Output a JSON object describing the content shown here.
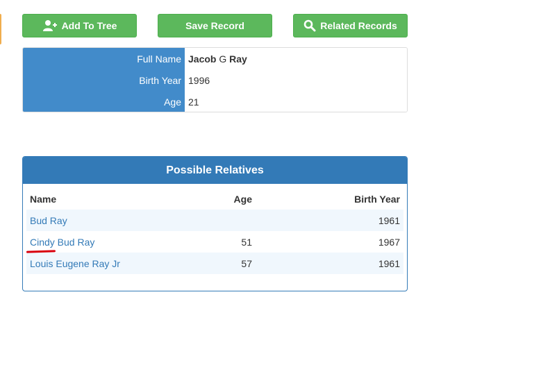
{
  "toolbar": {
    "add_to_tree": "Add To Tree",
    "save_record": "Save Record",
    "related_records": "Related Records"
  },
  "record": {
    "full_name_label": "Full Name",
    "full_name_first": "Jacob",
    "full_name_middle": "G",
    "full_name_last": "Ray",
    "birth_year_label": "Birth Year",
    "birth_year": "1996",
    "age_label": "Age",
    "age": "21"
  },
  "relatives": {
    "title": "Possible Relatives",
    "columns": {
      "name": "Name",
      "age": "Age",
      "birth_year": "Birth Year"
    },
    "rows": [
      {
        "name": "Bud Ray",
        "age": "",
        "birth_year": "1961"
      },
      {
        "name": "Cindy Bud Ray",
        "age": "51",
        "birth_year": "1967"
      },
      {
        "name": "Louis Eugene Ray Jr",
        "age": "57",
        "birth_year": "1961"
      }
    ]
  },
  "colors": {
    "button_green": "#5cb85c",
    "label_blue": "#428bca",
    "panel_blue": "#337ab7",
    "edge_orange": "#f0ad4e",
    "annotation_red": "#d9000d"
  }
}
